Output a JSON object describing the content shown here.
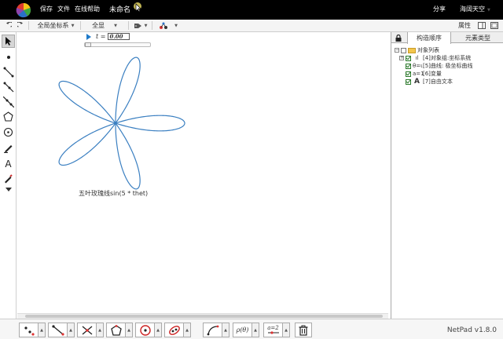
{
  "titlebar": {
    "menu": [
      "保存",
      "文件",
      "在线帮助"
    ],
    "document_name": "未命名",
    "share": "分享",
    "user": "海阔天空"
  },
  "toolbar": {
    "undo_icon": "undo-icon",
    "redo_icon": "redo-icon",
    "coord_select": "全局坐标系",
    "view_select": "全显",
    "attributes_button": "属性"
  },
  "parameter": {
    "label": "t =",
    "value": "0.00",
    "slider_value": 0
  },
  "curve": {
    "label": "五叶玫瑰线sin(5 * thet)",
    "petals": 5,
    "color": "#3a7fc1"
  },
  "panel": {
    "tabs": [
      "构造顺序",
      "元素类型"
    ],
    "active_tab": 0,
    "tree": [
      {
        "label": "对象列表",
        "type": "folder"
      },
      {
        "label": "[4]对象组:坐标系统",
        "icon": "ıl"
      },
      {
        "label": "[5]曲线: 极坐标曲线",
        "icon": "θ=ι"
      },
      {
        "label": "[6]变量",
        "icon": "a=1"
      },
      {
        "label": "[7]自由文本",
        "icon": "A"
      }
    ]
  },
  "bottom_tools": [
    "point-tool-icon",
    "segment-tool-icon",
    "intersection-tool-icon",
    "polygon-tool-icon",
    "circle-tool-icon",
    "conic-tool-icon",
    "curve-tool-icon",
    "polar-function-icon",
    "variable-tool-icon",
    "trash-icon"
  ],
  "bottom_labels": {
    "polar": "ρ(θ)",
    "variable": "a=2"
  },
  "version": "NetPad v1.8.0"
}
